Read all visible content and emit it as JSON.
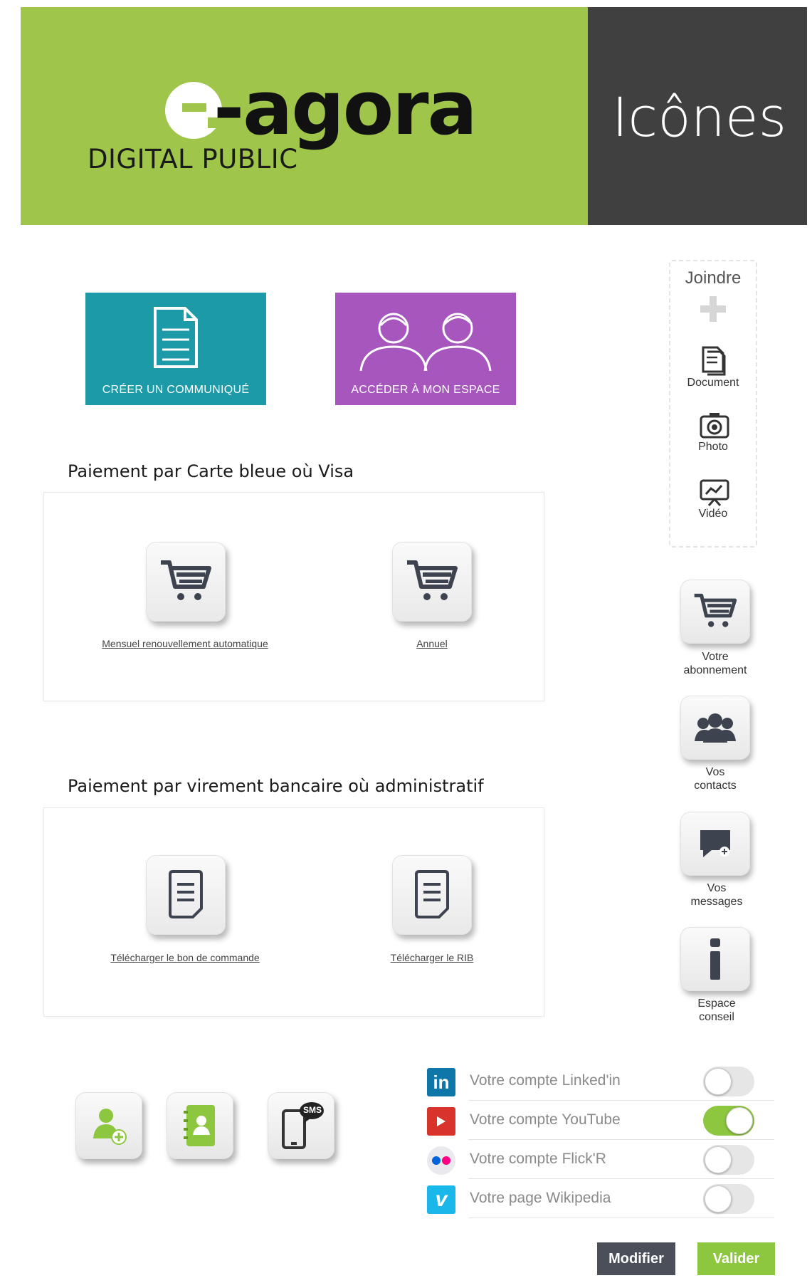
{
  "header": {
    "logo_word": "-agora",
    "logo_sub": "DIGITAL PUBLIC",
    "title": "Icônes"
  },
  "tiles": [
    {
      "label": "CRÉER UN COMMUNIQUÉ",
      "icon": "document-icon",
      "color": "#1c9aa8"
    },
    {
      "label": "ACCÉDER À MON ESPACE",
      "icon": "users-icon",
      "color": "#a656bd"
    }
  ],
  "card_payment": {
    "title": "Paiement par Carte bleue où Visa",
    "options": [
      {
        "label": "Mensuel renouvellement automatique",
        "icon": "cart-icon"
      },
      {
        "label": "Annuel",
        "icon": "cart-icon"
      }
    ]
  },
  "transfer_payment": {
    "title": "Paiement par virement bancaire où administratif",
    "options": [
      {
        "label": "Télécharger le bon de commande",
        "icon": "document-icon"
      },
      {
        "label": "Télécharger le RIB",
        "icon": "document-icon"
      }
    ]
  },
  "joindre": {
    "title": "Joindre",
    "items": [
      {
        "label": "Document",
        "icon": "document-icon"
      },
      {
        "label": "Photo",
        "icon": "camera-icon"
      },
      {
        "label": "Vidéo",
        "icon": "video-icon"
      }
    ]
  },
  "side_menu": [
    {
      "line1": "Votre",
      "line2": "abonnement",
      "icon": "cart-icon"
    },
    {
      "line1": "Vos",
      "line2": "contacts",
      "icon": "group-icon"
    },
    {
      "line1": "Vos",
      "line2": "messages",
      "icon": "chat-icon"
    },
    {
      "line1": "Espace",
      "line2": "conseil",
      "icon": "info-icon"
    }
  ],
  "contact_icons": [
    "add-user-icon",
    "address-book-icon",
    "sms-phone-icon"
  ],
  "contact_badge": "SMS",
  "social": [
    {
      "label": "Votre compte Linked'in",
      "icon": "linkedin-icon",
      "badge": "in",
      "enabled": false
    },
    {
      "label": "Votre compte YouTube",
      "icon": "youtube-icon",
      "enabled": true
    },
    {
      "label": "Votre compte Flick'R",
      "icon": "flickr-icon",
      "enabled": false
    },
    {
      "label": "Votre page Wikipedia",
      "icon": "vimeo-icon",
      "badge": "v",
      "enabled": false
    }
  ],
  "actions": {
    "modify": "Modifier",
    "validate": "Valider"
  },
  "colors": {
    "accent_green": "#8dc63f",
    "header_green": "#9fc54a",
    "header_dark": "#404040",
    "teal": "#1c9aa8",
    "purple": "#a656bd"
  }
}
